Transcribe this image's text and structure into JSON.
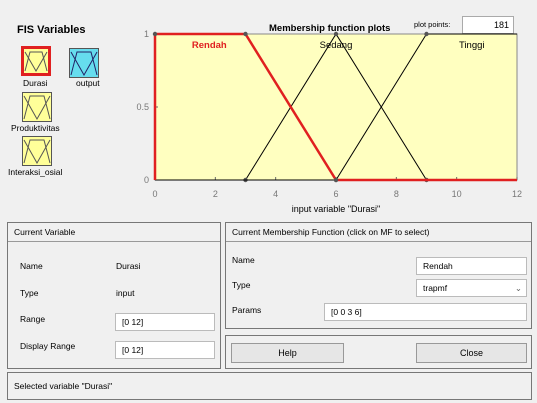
{
  "fis": {
    "title": "FIS Variables",
    "variables": [
      {
        "label": "Durasi"
      },
      {
        "label": "output"
      },
      {
        "label": "Produktivitas"
      },
      {
        "label": "Interaksi_osial"
      }
    ]
  },
  "plot": {
    "title": "Membership function plots",
    "plot_points_label": "plot points:",
    "plot_points_value": "181",
    "xlabel": "input variable \"Durasi\"",
    "x_ticks": [
      "0",
      "2",
      "4",
      "6",
      "8",
      "10",
      "12"
    ],
    "y_ticks": [
      "0",
      "0.5",
      "1"
    ],
    "mf_labels": [
      "Rendah",
      "Sedang",
      "Tinggi"
    ],
    "colors": {
      "bg": "#ffffc0",
      "selected": "#e02020",
      "normal": "#000000"
    }
  },
  "chart_data": {
    "type": "line",
    "xlim": [
      0,
      12
    ],
    "ylim": [
      0,
      1
    ],
    "series": [
      {
        "name": "Rendah",
        "x": [
          0,
          0,
          3,
          6,
          12
        ],
        "y": [
          0,
          1,
          1,
          0,
          0
        ],
        "selected": true
      },
      {
        "name": "Sedang",
        "x": [
          0,
          3,
          6,
          9,
          12
        ],
        "y": [
          0,
          0,
          1,
          0,
          0
        ],
        "selected": false
      },
      {
        "name": "Tinggi",
        "x": [
          0,
          6,
          9,
          12
        ],
        "y": [
          0,
          0,
          1,
          1
        ],
        "selected": false
      }
    ]
  },
  "current_variable": {
    "header": "Current Variable",
    "name_label": "Name",
    "name_value": "Durasi",
    "type_label": "Type",
    "type_value": "input",
    "range_label": "Range",
    "range_value": "[0 12]",
    "display_range_label": "Display Range",
    "display_range_value": "[0 12]"
  },
  "current_mf": {
    "header": "Current Membership Function (click on MF to select)",
    "name_label": "Name",
    "name_value": "Rendah",
    "type_label": "Type",
    "type_value": "trapmf",
    "params_label": "Params",
    "params_value": "[0 0 3 6]"
  },
  "buttons": {
    "help": "Help",
    "close": "Close"
  },
  "status": "Selected variable \"Durasi\""
}
